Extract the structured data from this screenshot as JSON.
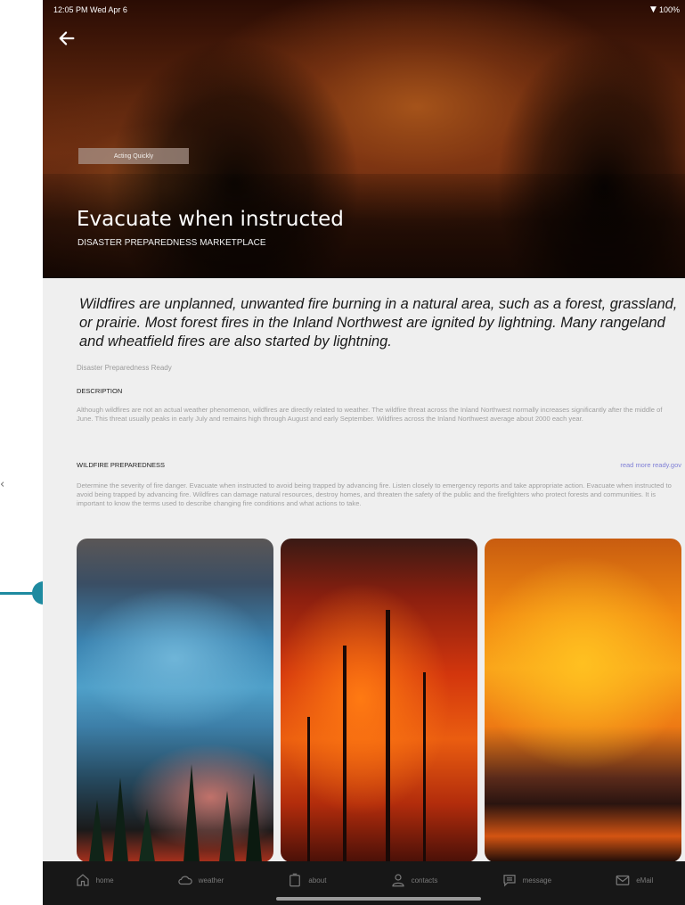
{
  "aside_glyph": "‹",
  "status": {
    "time": "12:05 PM  Wed Apr 6",
    "battery": "100%"
  },
  "hero": {
    "badge": "Acting Quickly",
    "title": "Evacuate when instructed",
    "subtitle": "DISASTER PREPAREDNESS MARKETPLACE"
  },
  "intro": "Wildfires are unplanned, unwanted fire burning in a natural area, such as a forest, grassland, or prairie. Most forest fires in the Inland Northwest are ignited by lightning. Many rangeland and wheatfield fires are also started by lightning.",
  "source": "Disaster Preparedness Ready",
  "description": {
    "heading": "DESCRIPTION",
    "body": "Although wildfires are not an actual weather phenomenon, wildfires are directly related to weather. The wildfire threat across the Inland Northwest normally increases significantly after the middle of June. This threat usually peaks in early July and remains high through August and early September. Wildfires across the Inland Northwest average about 2000 each year."
  },
  "preparedness": {
    "heading": "WILDFIRE PREPAREDNESS",
    "link": "read more ready.gov",
    "body": "Determine the severity of fire danger. Evacuate when instructed to avoid being trapped by advancing fire. Listen closely to emergency reports and take appropriate action. Evacuate when instructed to avoid being trapped by advancing fire. Wildfires can damage natural resources, destroy homes, and threaten the safety of the public and the firefighters who protect forests and communities. It is important to know the terms used to describe changing fire conditions and what actions to take."
  },
  "tabs": [
    {
      "label": "home",
      "icon": "home-icon"
    },
    {
      "label": "weather",
      "icon": "cloud-icon"
    },
    {
      "label": "about",
      "icon": "clipboard-icon"
    },
    {
      "label": "contacts",
      "icon": "person-icon"
    },
    {
      "label": "message",
      "icon": "message-icon"
    },
    {
      "label": "eMail",
      "icon": "mail-icon"
    }
  ],
  "colors": {
    "accent": "#1e8aa0",
    "link": "#7f7fd6",
    "tabbar": "#171717"
  }
}
